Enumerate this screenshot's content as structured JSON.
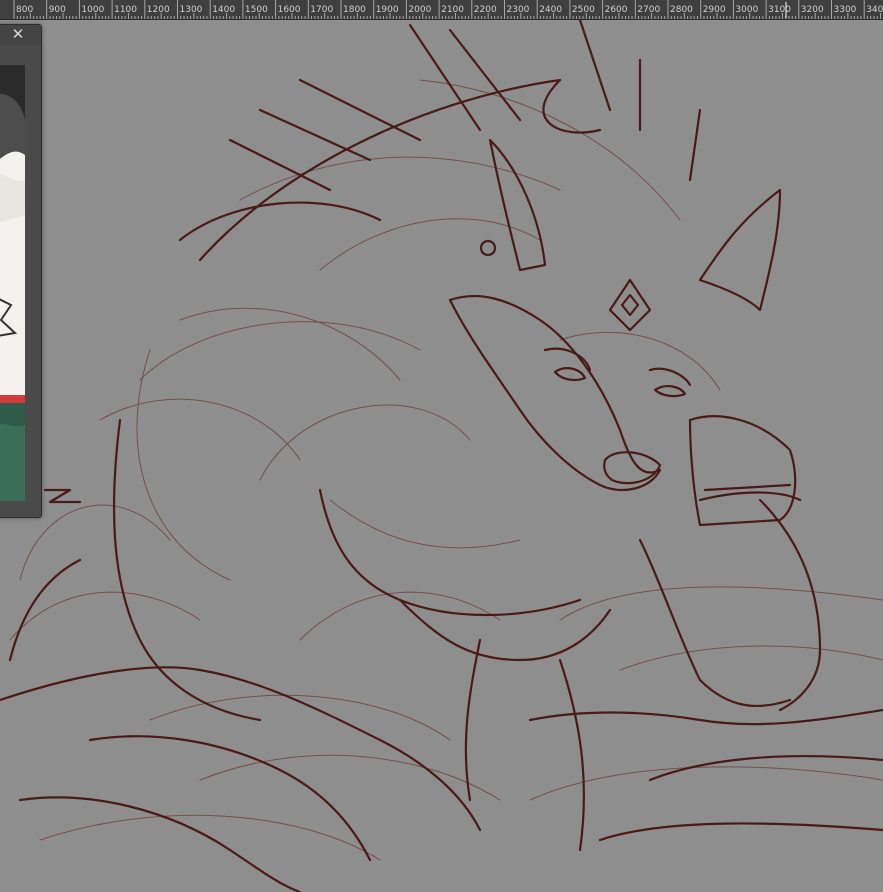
{
  "app": {
    "ruler": {
      "unit_labels": [
        "800",
        "900",
        "1000",
        "1100",
        "1200",
        "1300",
        "1400",
        "1500",
        "1600",
        "1700",
        "1800",
        "1900",
        "2000",
        "2100",
        "2200",
        "2300",
        "2400",
        "2500",
        "2600",
        "2700",
        "2800",
        "2900",
        "3000",
        "3100",
        "3200",
        "3300",
        "340"
      ]
    },
    "reference_panel": {
      "close_icon": "close-icon",
      "close_glyph": "✕"
    },
    "colors": {
      "canvas_bg": "#8e8e8e",
      "ruler_bg": "#3f3f3f",
      "ruler_text": "#d0d0d0",
      "panel_bg": "#4a4a4a",
      "line_dark": "#4a1a18",
      "line_sketch": "#6b3a36"
    }
  }
}
